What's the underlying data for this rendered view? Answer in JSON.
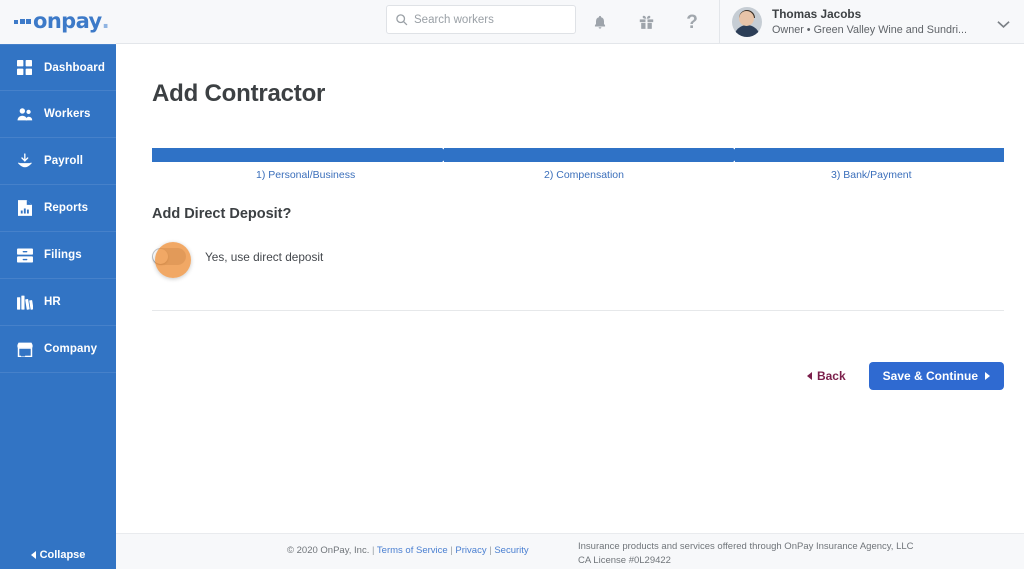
{
  "header": {
    "logo_text": "onpay",
    "logo_dot": ".",
    "search": {
      "placeholder": "Search workers",
      "value": "",
      "icon": "search-icon"
    },
    "icons": [
      {
        "name": "bell-icon",
        "label": "Notifications"
      },
      {
        "name": "gift-icon",
        "label": "Referrals"
      },
      {
        "name": "help-icon",
        "label": "?"
      }
    ],
    "user": {
      "name": "Thomas Jacobs",
      "role": "Owner • Green Valley Wine and Sundri...",
      "chevron": "chevron-down-icon"
    }
  },
  "sidebar": {
    "items": [
      {
        "label": "Dashboard",
        "icon": "grid-icon"
      },
      {
        "label": "Workers",
        "icon": "people-icon"
      },
      {
        "label": "Payroll",
        "icon": "payroll-hand-icon"
      },
      {
        "label": "Reports",
        "icon": "report-document-icon"
      },
      {
        "label": "Filings",
        "icon": "file-cabinet-icon"
      },
      {
        "label": "HR",
        "icon": "books-icon"
      },
      {
        "label": "Company",
        "icon": "storefront-icon"
      }
    ],
    "collapse_label": "Collapse"
  },
  "main": {
    "page_title": "Add Contractor",
    "steps": [
      {
        "label": "1) Personal/Business"
      },
      {
        "label": "2) Compensation"
      },
      {
        "label": "3) Bank/Payment"
      }
    ],
    "section_title": "Add Direct Deposit?",
    "toggle": {
      "label": "Yes, use direct deposit",
      "state": "off"
    },
    "back_label": "Back",
    "save_label": "Save & Continue"
  },
  "footer": {
    "copyright": "© 2020 OnPay, Inc.",
    "links": [
      {
        "label": "Terms of Service"
      },
      {
        "label": "Privacy"
      },
      {
        "label": "Security"
      }
    ],
    "insurance_line1": "Insurance products and services offered through OnPay Insurance Agency, LLC",
    "insurance_line2": "CA License #0L29422"
  },
  "colors": {
    "sidebar_blue": "#3274c4",
    "progress_blue": "#2f72c6",
    "primary_button": "#2f6ad1",
    "back_link": "#7b1f4b",
    "click_highlight": "#eb862a"
  }
}
